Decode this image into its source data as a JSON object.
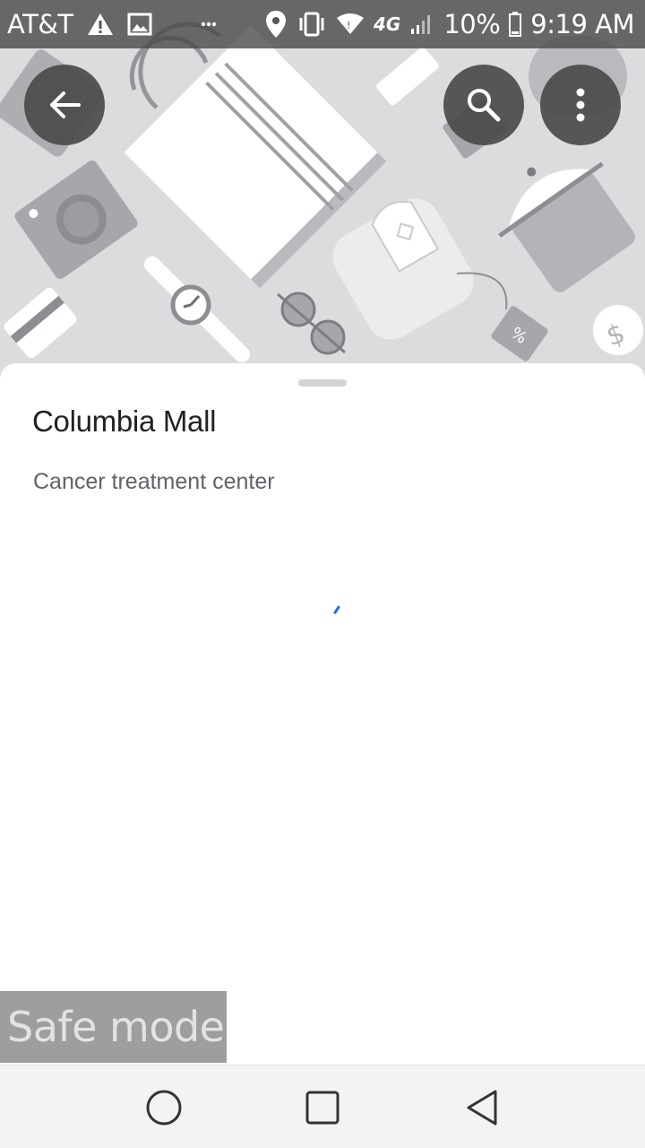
{
  "status_bar": {
    "carrier": "AT&T",
    "icons": [
      "warning-icon",
      "image-icon",
      "more-dots-icon",
      "location-icon",
      "vibrate-icon",
      "wifi-icon",
      "lte-icon",
      "signal-icon",
      "battery-icon"
    ],
    "network": "4G",
    "battery": "10%",
    "time": "9:19 AM"
  },
  "header": {
    "icons": [
      "back-arrow-icon",
      "search-icon",
      "more-vert-icon"
    ]
  },
  "place": {
    "title": "Columbia Mall",
    "category": "Cancer treatment center"
  },
  "overlay": {
    "safe_mode_label": "Safe mode"
  },
  "nav_bar": {
    "icons": [
      "home-circle-icon",
      "recents-square-icon",
      "back-triangle-icon"
    ]
  },
  "colors": {
    "hero_background": "#dcdcde",
    "title": "#202124",
    "subtitle": "#5f6368",
    "spinner": "#1a73e8"
  }
}
